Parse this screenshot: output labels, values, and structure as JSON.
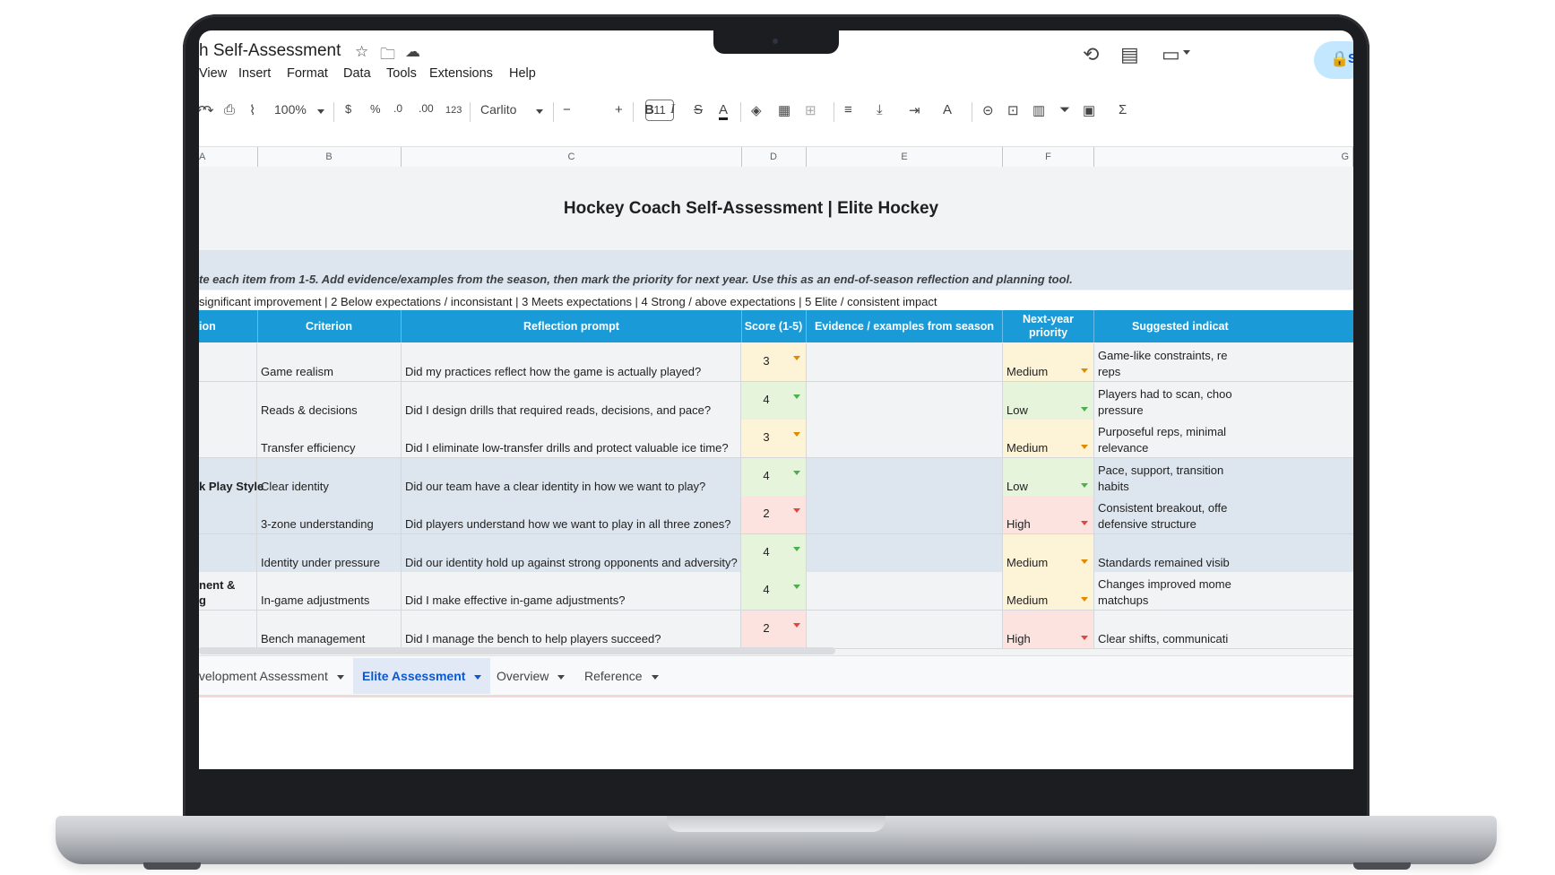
{
  "doc": {
    "title": "h Self-Assessment",
    "menu": [
      "View",
      "Insert",
      "Format",
      "Data",
      "Tools",
      "Extensions",
      "Help"
    ]
  },
  "toolbar": {
    "zoom": "100%",
    "currency": "$",
    "percent": "%",
    "dec_decrease": ".0",
    "dec_increase": ".00",
    "number_format": "123",
    "font": "Carlito",
    "font_size": "11",
    "bold": "B",
    "italic": "I",
    "share_label": "Sh"
  },
  "columns": [
    "A",
    "B",
    "C",
    "D",
    "E",
    "F",
    "G"
  ],
  "sheet": {
    "title": "Hockey Coach Self-Assessment | Elite Hockey",
    "instructions": "te each item from 1-5. Add evidence/examples from the season, then mark the priority for next year. Use this as an end-of-season reflection and planning tool.",
    "scale": "significant improvement | 2 Below expectations / inconsistant | 3 Meets expectations | 4 Strong / above expectations | 5 Elite / consistent impact",
    "headers": {
      "section": "ion",
      "criterion": "Criterion",
      "prompt": "Reflection prompt",
      "score": "Score (1-5)",
      "evidence": "Evidence / examples from season",
      "priority_line1": "Next-year",
      "priority_line2": "priority",
      "indicators": "Suggested indicat"
    },
    "rows": [
      {
        "section_l1": "",
        "section_l2": "",
        "criterion": "Game realism",
        "prompt": "Did my practices reflect how the game is actually played?",
        "score": "3",
        "priority": "Medium",
        "ind1": "Game-like constraints, re",
        "ind2": "reps"
      },
      {
        "section_l1": "",
        "section_l2": "",
        "criterion": "Reads & decisions",
        "prompt": "Did I design drills that required reads, decisions, and pace?",
        "score": "4",
        "priority": "Low",
        "ind1": "Players had to scan, choo",
        "ind2": "pressure"
      },
      {
        "section_l1": "",
        "section_l2": "",
        "criterion": "Transfer efficiency",
        "prompt": "Did I eliminate low-transfer drills and protect valuable ice time?",
        "score": "3",
        "priority": "Medium",
        "ind1": "Purposeful reps, minimal",
        "ind2": "relevance"
      },
      {
        "section_l1": "",
        "section_l2": "k Play Style",
        "criterion": "Clear identity",
        "prompt": "Did our team have a clear identity in how we want to play?",
        "score": "4",
        "priority": "Low",
        "ind1": "Pace, support, transition",
        "ind2": "habits"
      },
      {
        "section_l1": "",
        "section_l2": "",
        "criterion": "3-zone understanding",
        "prompt": "Did players understand how we want to play in all three zones?",
        "score": "2",
        "priority": "High",
        "ind1": "Consistent breakout, offe",
        "ind2": "defensive structure"
      },
      {
        "section_l1": "",
        "section_l2": "",
        "criterion": "Identity under pressure",
        "prompt": "Did our identity hold up against strong opponents and adversity?",
        "score": "4",
        "priority": "Medium",
        "ind1": "",
        "ind2": "Standards remained visib"
      },
      {
        "section_l1": "nent &",
        "section_l2": "g",
        "criterion": "In-game adjustments",
        "prompt": "Did I make effective in-game adjustments?",
        "score": "4",
        "priority": "Medium",
        "ind1": "Changes improved mome",
        "ind2": "matchups"
      },
      {
        "section_l1": "",
        "section_l2": "",
        "criterion": "Bench management",
        "prompt": "Did I manage the bench to help players succeed?",
        "score": "2",
        "priority": "High",
        "ind1": "",
        "ind2": "Clear shifts, communicati"
      }
    ]
  },
  "tabs": [
    {
      "label": "Development Assessment",
      "active": false
    },
    {
      "label": "Elite Assessment",
      "active": true
    },
    {
      "label": "Overview",
      "active": false
    },
    {
      "label": "Reference",
      "active": false
    }
  ],
  "colors": {
    "header_blue": "#1a9bd7",
    "score_3": "#fdf4d8",
    "score_4": "#e6f4dc",
    "score_2": "#fde3df",
    "priority_medium": "#fdf4d8",
    "priority_low": "#e6f4dc",
    "priority_high": "#fde3df",
    "section_band": "#dde6ef"
  }
}
